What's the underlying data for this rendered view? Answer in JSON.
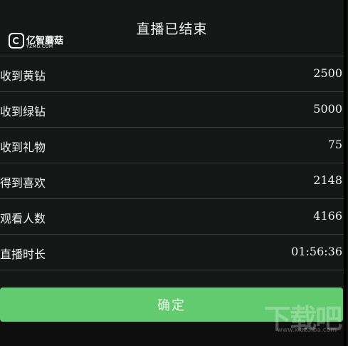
{
  "dialog": {
    "title": "直播已结束",
    "confirm_label": "确定"
  },
  "logo": {
    "name": "亿智蘑菇",
    "domain": "YZMG.COM"
  },
  "stats": [
    {
      "label": "收到黄钻",
      "value": "2500"
    },
    {
      "label": "收到绿钻",
      "value": "5000"
    },
    {
      "label": "收到礼物",
      "value": "75"
    },
    {
      "label": "得到喜欢",
      "value": "2148"
    },
    {
      "label": "观看人数",
      "value": "4166"
    },
    {
      "label": "直播时长",
      "value": "01:56:36"
    }
  ],
  "watermark": {
    "text": "下载吧",
    "sub": "www.xiazaiba.com"
  },
  "colors": {
    "background": "#151816",
    "confirm_button": "#63cb6f",
    "divider": "#3a3d3b"
  }
}
